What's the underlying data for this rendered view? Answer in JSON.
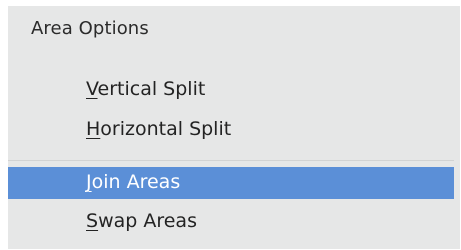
{
  "menu": {
    "header": "Area Options",
    "items": [
      {
        "mnemonic": "V",
        "rest": "ertical Split",
        "highlighted": false
      },
      {
        "mnemonic": "H",
        "rest": "orizontal Split",
        "highlighted": false
      },
      {
        "mnemonic": "J",
        "rest": "oin Areas",
        "highlighted": true
      },
      {
        "mnemonic": "S",
        "rest": "wap Areas",
        "highlighted": false
      }
    ]
  },
  "colors": {
    "menu_background": "#e6e7e7",
    "highlight": "#5b8fd7",
    "text": "#232323",
    "highlight_text": "#ffffff"
  }
}
